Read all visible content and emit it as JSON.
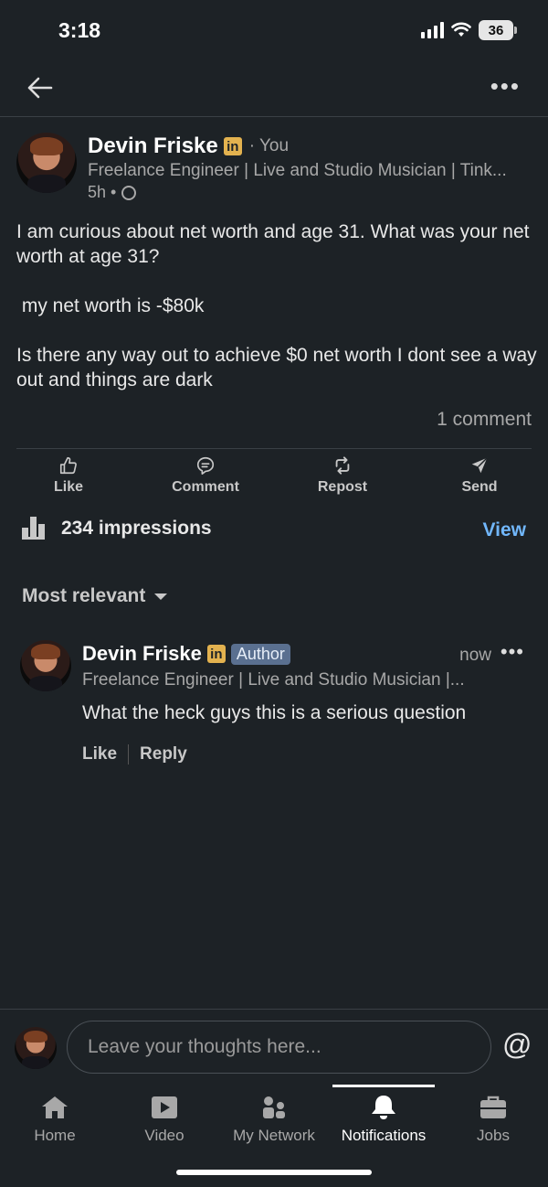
{
  "status_bar": {
    "time": "3:18",
    "battery": "36"
  },
  "post": {
    "author": "Devin Friske",
    "linkedin_badge": "in",
    "relation": "· You",
    "headline": "Freelance Engineer | Live and Studio Musician | Tink...",
    "age": "5h •",
    "body": [
      "I am curious about net worth and age 31.  What was your net worth at age 31?",
      " my net worth is -$80k",
      "Is there any way out to achieve $0 net worth I dont see a way out and things are dark"
    ],
    "comment_count": "1 comment"
  },
  "actions": {
    "like": "Like",
    "comment": "Comment",
    "repost": "Repost",
    "send": "Send"
  },
  "impressions": {
    "text": "234 impressions",
    "view": "View"
  },
  "sort": {
    "label": "Most relevant"
  },
  "comment": {
    "author": "Devin Friske",
    "linkedin_badge": "in",
    "badge": "Author",
    "time": "now",
    "headline": "Freelance Engineer | Live and Studio Musician |...",
    "text": "What the heck guys this is a serious question",
    "like": "Like",
    "reply": "Reply"
  },
  "composer": {
    "placeholder": "Leave your thoughts here...",
    "mention": "@"
  },
  "tabs": [
    {
      "label": "Home",
      "icon": "home-icon"
    },
    {
      "label": "Video",
      "icon": "video-icon"
    },
    {
      "label": "My Network",
      "icon": "network-icon"
    },
    {
      "label": "Notifications",
      "icon": "bell-icon",
      "active": true
    },
    {
      "label": "Jobs",
      "icon": "briefcase-icon"
    }
  ]
}
